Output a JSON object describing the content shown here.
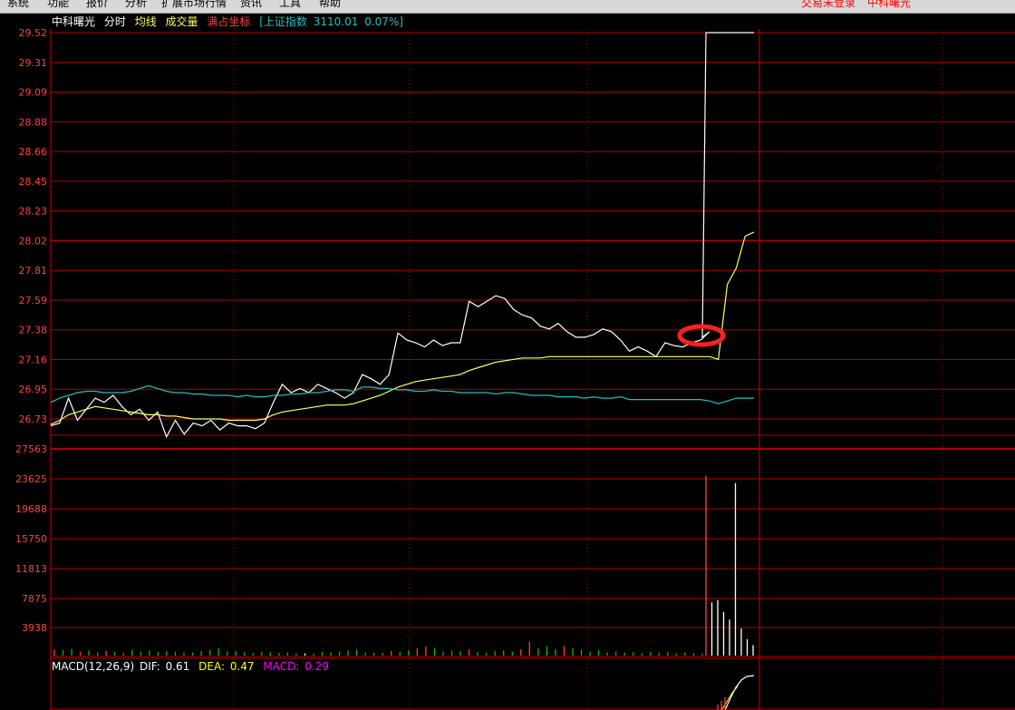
{
  "menu": {
    "items": [
      "系统",
      "功能",
      "报价",
      "分析",
      "扩展市场行情",
      "资讯",
      "工具",
      "帮助"
    ],
    "status_login": "交易未登录",
    "status_stock": "中科曙光"
  },
  "header": {
    "stock_name": "中科曙光",
    "mode": "分时",
    "avg_line": "均线",
    "volume": "成交量",
    "full_coord": "满占坐标",
    "index_name": "[上证指数",
    "index_value": "3110.01",
    "index_change": "0.07%]"
  },
  "colors": {
    "grid": "#b00000",
    "axis_price": "#ff4040",
    "price_line": "#ffffff",
    "avg_line": "#ffff60",
    "index_line": "#20c0c0",
    "vol_up": "#ff4040",
    "vol_down": "#00c000",
    "vol_flat": "#ffffff",
    "macd_label": "#ffffff",
    "dif": "#ffffff",
    "dea": "#ffff00",
    "macd": "#ff00ff",
    "annotation": "#ff2020"
  },
  "macd": {
    "label": "MACD(12,26,9)",
    "dif_label": "DIF:",
    "dif_value": "0.61",
    "dea_label": "DEA:",
    "dea_value": "0.47",
    "macd_label": "MACD:",
    "macd_value": "0.29"
  },
  "chart_data": [
    {
      "type": "line",
      "price_ticks": [
        "29.52",
        "29.31",
        "29.09",
        "28.88",
        "28.66",
        "28.45",
        "28.23",
        "28.02",
        "27.81",
        "27.59",
        "27.38",
        "27.16",
        "26.95",
        "26.73"
      ],
      "ylim": [
        26.73,
        29.52
      ],
      "x_minutes": [
        240
      ],
      "series": [
        {
          "name": "price",
          "values": [
            26.68,
            26.7,
            26.88,
            26.72,
            26.8,
            26.88,
            26.85,
            26.9,
            26.82,
            26.76,
            26.8,
            26.72,
            26.78,
            26.6,
            26.72,
            26.62,
            26.7,
            26.68,
            26.72,
            26.65,
            26.7,
            26.68,
            26.68,
            26.66,
            26.7,
            26.85,
            26.98,
            26.92,
            26.95,
            26.92,
            26.98,
            26.95,
            26.92,
            26.88,
            26.92,
            27.05,
            27.02,
            26.98,
            27.05,
            27.35,
            27.3,
            27.28,
            27.25,
            27.3,
            27.26,
            27.28,
            27.28,
            27.58,
            27.54,
            27.58,
            27.62,
            27.6,
            27.52,
            27.48,
            27.46,
            27.4,
            27.38,
            27.42,
            27.36,
            27.32,
            27.32,
            27.34,
            27.38,
            27.36,
            27.3,
            27.22,
            27.25,
            27.22,
            27.18,
            27.28,
            27.26,
            27.25,
            27.28,
            27.3,
            27.36,
            27.32,
            29.52,
            29.52,
            29.52,
            29.52
          ]
        },
        {
          "name": "avg",
          "values": [
            26.69,
            26.72,
            26.76,
            26.78,
            26.8,
            26.82,
            26.81,
            26.8,
            26.79,
            26.78,
            26.77,
            26.76,
            26.76,
            26.75,
            26.75,
            26.74,
            26.73,
            26.73,
            26.73,
            26.73,
            26.72,
            26.72,
            26.72,
            26.72,
            26.73,
            26.76,
            26.78,
            26.79,
            26.8,
            26.81,
            26.82,
            26.83,
            26.83,
            26.83,
            26.84,
            26.86,
            26.88,
            26.9,
            26.93,
            26.96,
            26.98,
            27.0,
            27.01,
            27.02,
            27.03,
            27.04,
            27.05,
            27.08,
            27.1,
            27.12,
            27.14,
            27.15,
            27.16,
            27.17,
            27.17,
            27.17,
            27.18,
            27.18,
            27.18,
            27.18,
            27.18,
            27.18,
            27.18,
            27.18,
            27.18,
            27.18,
            27.18,
            27.18,
            27.18,
            27.18,
            27.18,
            27.18,
            27.18,
            27.18,
            27.18,
            27.16,
            27.7,
            27.82,
            28.05,
            28.08
          ]
        },
        {
          "name": "index",
          "values": [
            26.85,
            26.88,
            26.9,
            26.92,
            26.93,
            26.93,
            26.92,
            26.92,
            26.92,
            26.93,
            26.95,
            26.97,
            26.95,
            26.93,
            26.92,
            26.92,
            26.91,
            26.91,
            26.9,
            26.9,
            26.9,
            26.89,
            26.9,
            26.89,
            26.89,
            26.9,
            26.9,
            26.91,
            26.91,
            26.92,
            26.92,
            26.93,
            26.94,
            26.94,
            26.93,
            26.96,
            26.96,
            26.95,
            26.95,
            26.94,
            26.94,
            26.93,
            26.93,
            26.94,
            26.93,
            26.93,
            26.92,
            26.92,
            26.92,
            26.92,
            26.91,
            26.92,
            26.92,
            26.91,
            26.9,
            26.9,
            26.9,
            26.89,
            26.89,
            26.89,
            26.88,
            26.89,
            26.88,
            26.88,
            26.89,
            26.87,
            26.87,
            26.87,
            26.87,
            26.87,
            26.87,
            26.87,
            26.87,
            26.87,
            26.86,
            26.84,
            26.86,
            26.88,
            26.88,
            26.88
          ]
        }
      ]
    },
    {
      "type": "bar",
      "volume_ticks": [
        "27563",
        "23625",
        "19688",
        "15750",
        "11813",
        "7875",
        "3938"
      ],
      "ylim": [
        0,
        27563
      ],
      "values": [
        820,
        740,
        900,
        500,
        660,
        420,
        620,
        480,
        360,
        760,
        540,
        660,
        480,
        580,
        520,
        380,
        410,
        620,
        740,
        980,
        540,
        620,
        460,
        380,
        520,
        440,
        340,
        420,
        280,
        300,
        260,
        500,
        420,
        540,
        660,
        780,
        420,
        360,
        380,
        620,
        500,
        700,
        960,
        1200,
        980,
        540,
        660,
        580,
        820,
        460,
        360,
        620,
        700,
        520,
        840,
        1840,
        980,
        1220,
        860,
        1280,
        980,
        760,
        520,
        680,
        420,
        560,
        380,
        460,
        340,
        500,
        380,
        480,
        280,
        420,
        340,
        260,
        24000,
        7100,
        7400,
        5800,
        4800,
        23000,
        3600,
        2200,
        1400
      ],
      "directions": [
        "u",
        "d",
        "d",
        "u",
        "d",
        "d",
        "u",
        "d",
        "d",
        "d",
        "d",
        "d",
        "d",
        "d",
        "d",
        "d",
        "d",
        "d",
        "d",
        "d",
        "d",
        "d",
        "d",
        "d",
        "d",
        "d",
        "d",
        "d",
        "d",
        "f",
        "d",
        "d",
        "d",
        "d",
        "d",
        "d",
        "d",
        "d",
        "d",
        "u",
        "d",
        "d",
        "u",
        "u",
        "d",
        "d",
        "d",
        "d",
        "u",
        "d",
        "d",
        "d",
        "d",
        "d",
        "u",
        "u",
        "d",
        "d",
        "d",
        "u",
        "d",
        "d",
        "d",
        "d",
        "d",
        "d",
        "d",
        "d",
        "d",
        "d",
        "d",
        "d",
        "d",
        "d",
        "d",
        "d",
        "u",
        "f",
        "f",
        "f",
        "f",
        "f",
        "f",
        "f",
        "f"
      ]
    }
  ]
}
